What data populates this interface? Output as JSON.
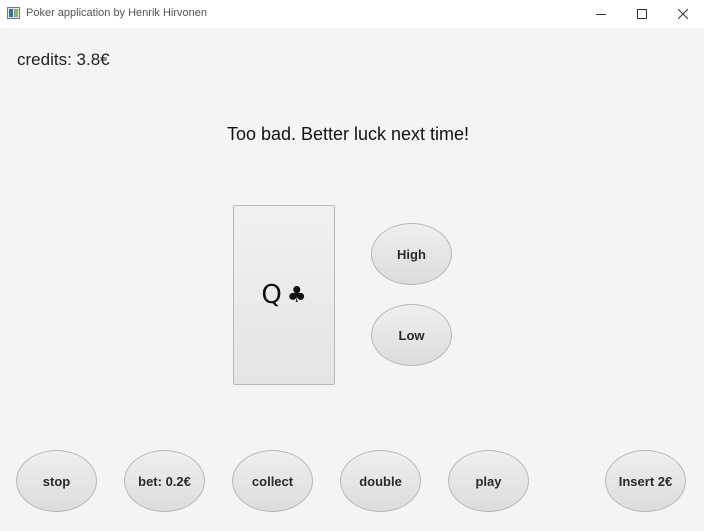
{
  "window": {
    "title": "Poker application by Henrik Hirvonen",
    "icon": "app-icon",
    "controls": [
      "minimize-icon",
      "maximize-icon",
      "close-icon"
    ]
  },
  "game": {
    "credits": "credits: 3.8€",
    "message": "Too bad. Better luck next time!",
    "card": {
      "rank": "Q",
      "suit": "♣"
    }
  },
  "guess_buttons": {
    "high": "High",
    "low": "Low"
  },
  "bottom_buttons": {
    "stop": "stop",
    "bet": "bet: 0.2€",
    "collect": "collect",
    "double": "double",
    "play": "play",
    "insert": "Insert 2€"
  },
  "colors": {
    "background": "#f4f4f4",
    "titlebar": "#ffffff",
    "button_border": "#b8b8b8",
    "text": "#222222"
  }
}
